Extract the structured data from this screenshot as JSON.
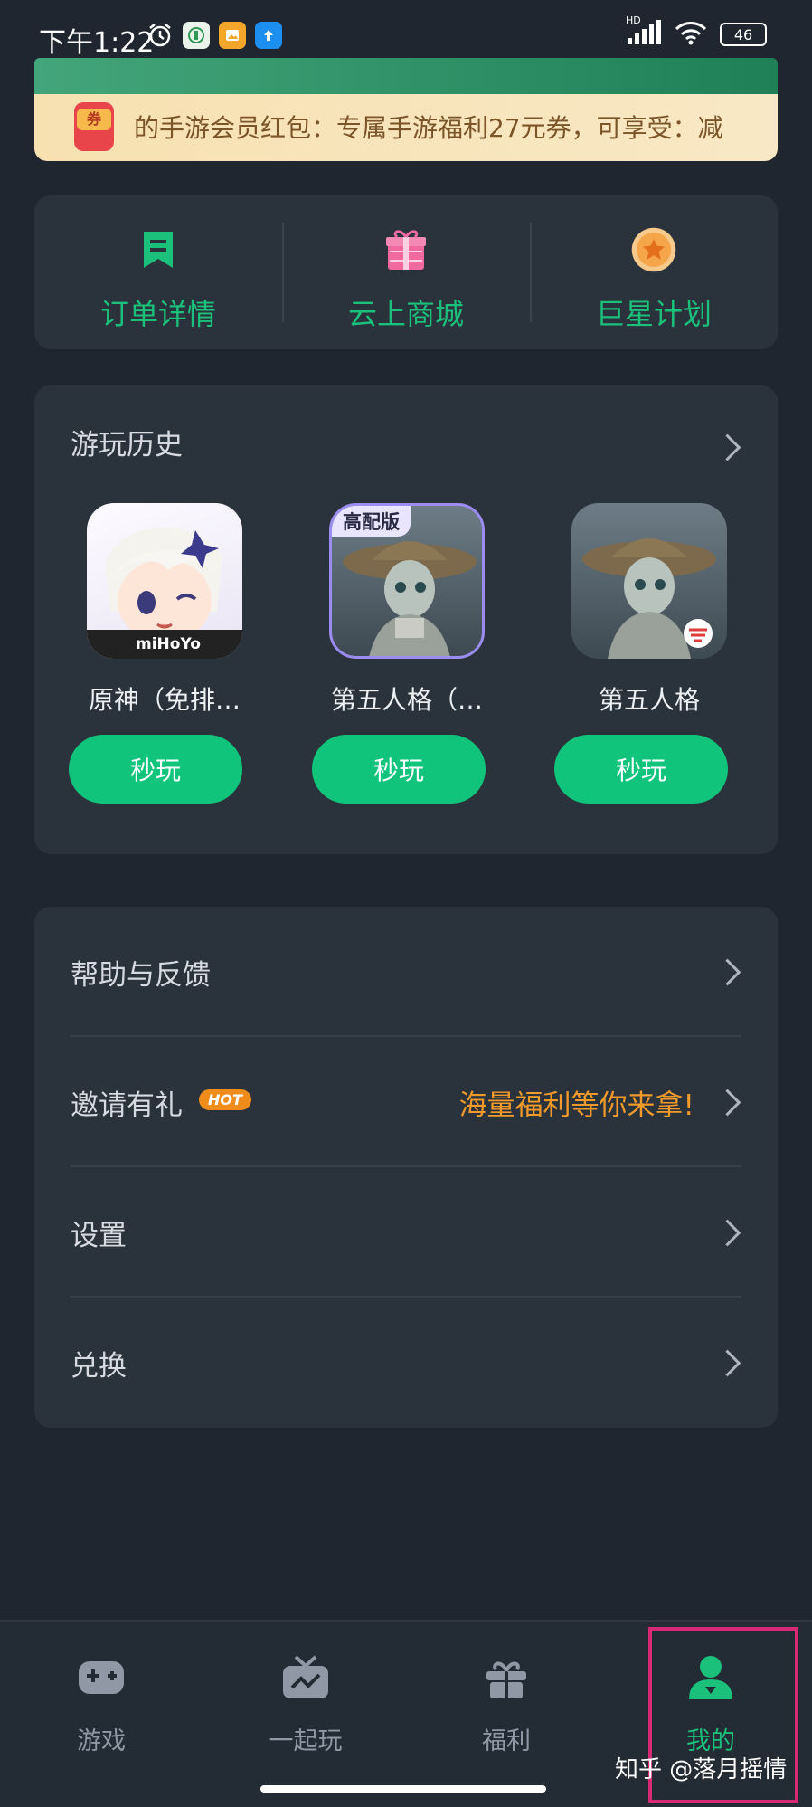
{
  "status_bar": {
    "time": "下午1:22",
    "network_label": "HD",
    "battery": "46"
  },
  "promo_banner": {
    "icon_label": "券",
    "text": "的手游会员红包：专属手游福利27元券，可享受：减"
  },
  "quick_actions": [
    {
      "label": "订单详情",
      "icon": "bookmark-icon"
    },
    {
      "label": "云上商城",
      "icon": "gift-icon"
    },
    {
      "label": "巨星计划",
      "icon": "star-badge-icon"
    }
  ],
  "history": {
    "title": "游玩历史",
    "games": [
      {
        "name": "原神（免排…",
        "badge": "",
        "logo_text": "miHoYo",
        "play_label": "秒玩"
      },
      {
        "name": "第五人格（…",
        "badge": "高配版",
        "logo_text": "",
        "play_label": "秒玩"
      },
      {
        "name": "第五人格",
        "badge": "",
        "logo_text": "",
        "play_label": "秒玩"
      }
    ]
  },
  "menu": {
    "items": [
      {
        "label": "帮助与反馈"
      },
      {
        "label": "邀请有礼",
        "badge": "HOT",
        "promo": "海量福利等你来拿!"
      },
      {
        "label": "设置"
      },
      {
        "label": "兑换"
      }
    ]
  },
  "tabbar": {
    "tabs": [
      {
        "label": "游戏",
        "icon": "gamepad-icon"
      },
      {
        "label": "一起玩",
        "icon": "tv-icon"
      },
      {
        "label": "福利",
        "icon": "gift-icon"
      },
      {
        "label": "我的",
        "icon": "user-icon",
        "active": true
      }
    ]
  },
  "watermark": "知乎 @落月摇情",
  "colors": {
    "accent": "#11c47b",
    "background": "#1f2630",
    "card": "#2a323c",
    "promo": "#f29a2a",
    "highlight": "#d62976"
  }
}
